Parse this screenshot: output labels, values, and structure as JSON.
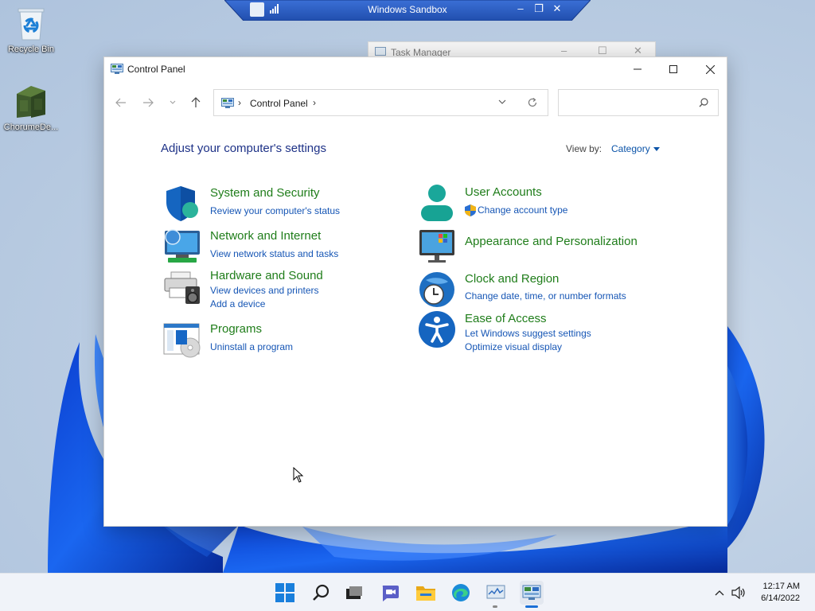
{
  "desktop": {
    "icons": [
      {
        "label": "Recycle Bin"
      },
      {
        "label": "ChorumeDe..."
      }
    ]
  },
  "sandbox": {
    "title": "Windows Sandbox"
  },
  "background_window": {
    "title": "Task Manager"
  },
  "window": {
    "title": "Control Panel",
    "address": {
      "path": "Control Panel"
    },
    "search": {
      "placeholder": "",
      "value": ""
    },
    "heading": "Adjust your computer's settings",
    "view_by": {
      "label": "View by:",
      "value": "Category"
    },
    "categories": [
      {
        "title": "System and Security",
        "links": [
          "Review your computer's status"
        ]
      },
      {
        "title": "Network and Internet",
        "links": [
          "View network status and tasks"
        ]
      },
      {
        "title": "Hardware and Sound",
        "links": [
          "View devices and printers",
          "Add a device"
        ]
      },
      {
        "title": "Programs",
        "links": [
          "Uninstall a program"
        ]
      },
      {
        "title": "User Accounts",
        "links": [
          "Change account type"
        ]
      },
      {
        "title": "Appearance and Personalization",
        "links": []
      },
      {
        "title": "Clock and Region",
        "links": [
          "Change date, time, or number formats"
        ]
      },
      {
        "title": "Ease of Access",
        "links": [
          "Let Windows suggest settings",
          "Optimize visual display"
        ]
      }
    ]
  },
  "taskbar": {
    "apps": [
      "start-icon",
      "search-icon",
      "task-view-icon",
      "chat-icon",
      "file-explorer-icon",
      "edge-icon",
      "task-manager-icon",
      "control-panel-icon"
    ],
    "clock": {
      "time": "12:17 AM",
      "date": "6/14/2022"
    }
  },
  "colors": {
    "heading": "#1e3287",
    "category_title": "#1f7d1a",
    "link": "#1656b5",
    "accent": "#0a53a8"
  }
}
